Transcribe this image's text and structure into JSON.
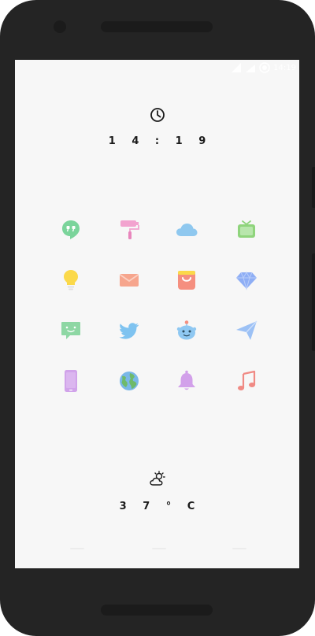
{
  "status_bar": {
    "time": "14:19",
    "icons": [
      "signal-icon",
      "wifi-icon",
      "battery-icon"
    ]
  },
  "clock": {
    "icon": "clock-icon",
    "time": "1 4 : 1 9"
  },
  "apps": [
    {
      "name": "hangouts-icon",
      "color": "#7bd49b"
    },
    {
      "name": "paint-roller-icon",
      "color": "#f2a3cf"
    },
    {
      "name": "cloud-icon",
      "color": "#8fc8ef"
    },
    {
      "name": "tv-icon",
      "color": "#8fd47c"
    },
    {
      "name": "lightbulb-icon",
      "color": "#fbd94a"
    },
    {
      "name": "mail-icon",
      "color": "#f6a58d"
    },
    {
      "name": "shopping-bag-icon",
      "color": "#f58f7f"
    },
    {
      "name": "diamond-icon",
      "color": "#8eaef5"
    },
    {
      "name": "chat-icon",
      "color": "#8ed7a4"
    },
    {
      "name": "twitter-icon",
      "color": "#7fc3f0"
    },
    {
      "name": "robot-icon",
      "color": "#8fc8f2"
    },
    {
      "name": "send-icon",
      "color": "#9cc1f5"
    },
    {
      "name": "phone-icon",
      "color": "#d1a3ea"
    },
    {
      "name": "globe-icon",
      "color": "#7ab8e8"
    },
    {
      "name": "bell-icon",
      "color": "#d2a0ea"
    },
    {
      "name": "music-icon",
      "color": "#f08a84"
    }
  ],
  "weather": {
    "icon": "partly-cloudy-icon",
    "temperature": "3 7 ° C"
  },
  "colors": {
    "device": "#242424",
    "screen": "#f7f7f7",
    "text": "#1a1a1a"
  }
}
